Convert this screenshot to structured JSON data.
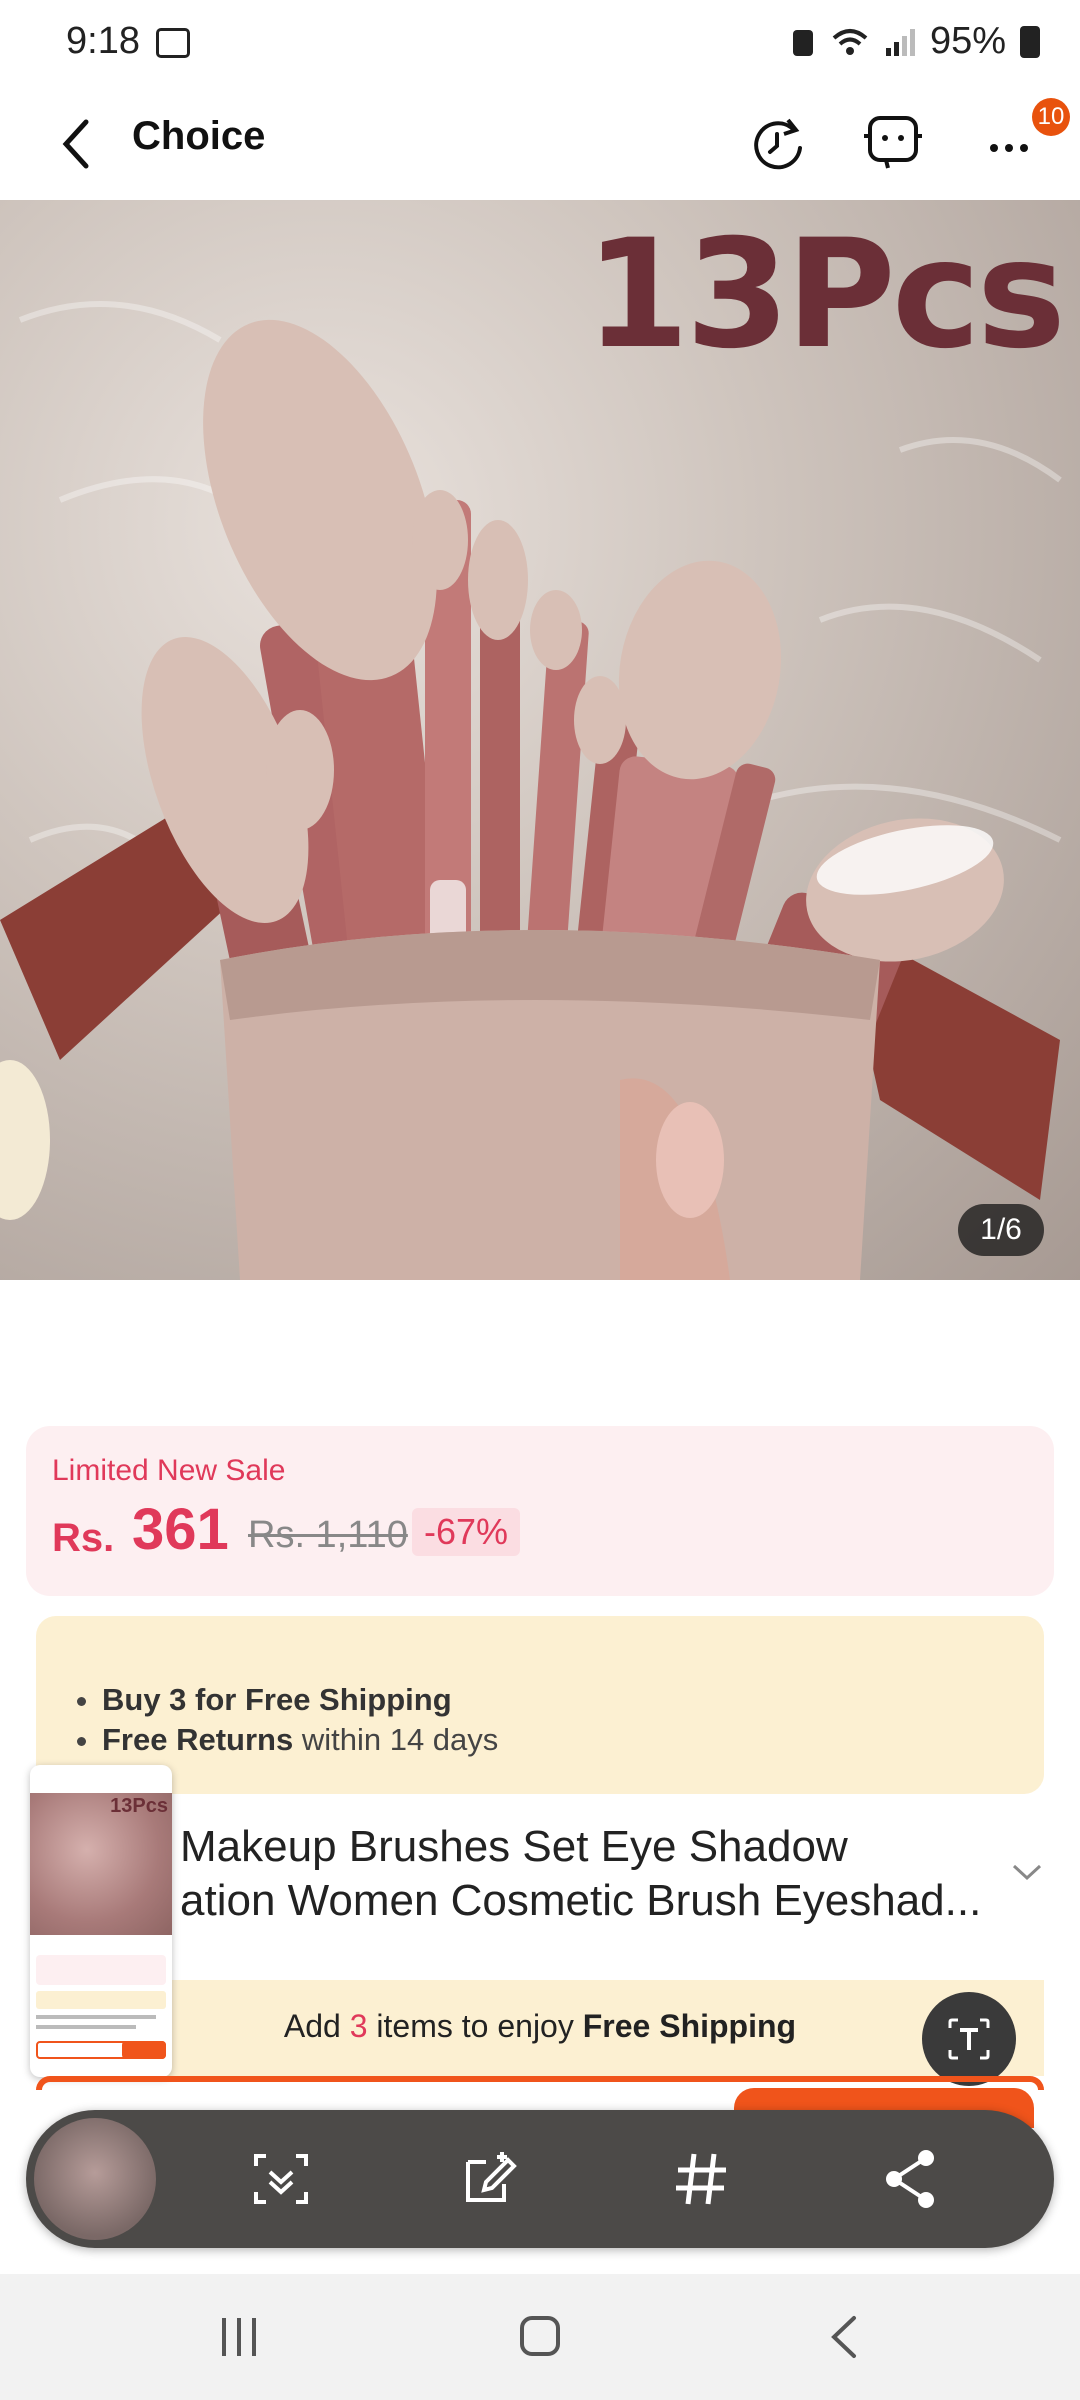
{
  "status_bar": {
    "time": "9:18",
    "battery": "95%"
  },
  "header": {
    "title": "Choice",
    "notification_count": "10"
  },
  "hero": {
    "overlay_text": "13Pcs",
    "counter": "1/6"
  },
  "sale": {
    "label": "Limited New Sale",
    "currency": "Rs.",
    "price": "361",
    "old_price": "Rs. 1,110",
    "discount": "-67%"
  },
  "promo": {
    "line1_bold": "Buy 3 for  Free Shipping",
    "line2_bold": "Free Returns",
    "line2_rest": " within 14 days"
  },
  "product": {
    "title_line1": "Makeup Brushes Set Eye Shadow",
    "title_line2": "ation Women Cosmetic Brush Eyeshad..."
  },
  "shipping_bar": {
    "prefix": "Add ",
    "count": "3",
    "middle": " items to enjoy ",
    "bold": "Free Shipping"
  },
  "mini_preview": {
    "overlay_text": "13Pcs"
  },
  "toolbar": {
    "icons": [
      "scan-icon",
      "edit-icon",
      "hashtag-icon",
      "share-icon"
    ]
  },
  "colors": {
    "accent": "#e0395a",
    "orange": "#f0541b",
    "promo_bg": "#fcf0d2"
  }
}
